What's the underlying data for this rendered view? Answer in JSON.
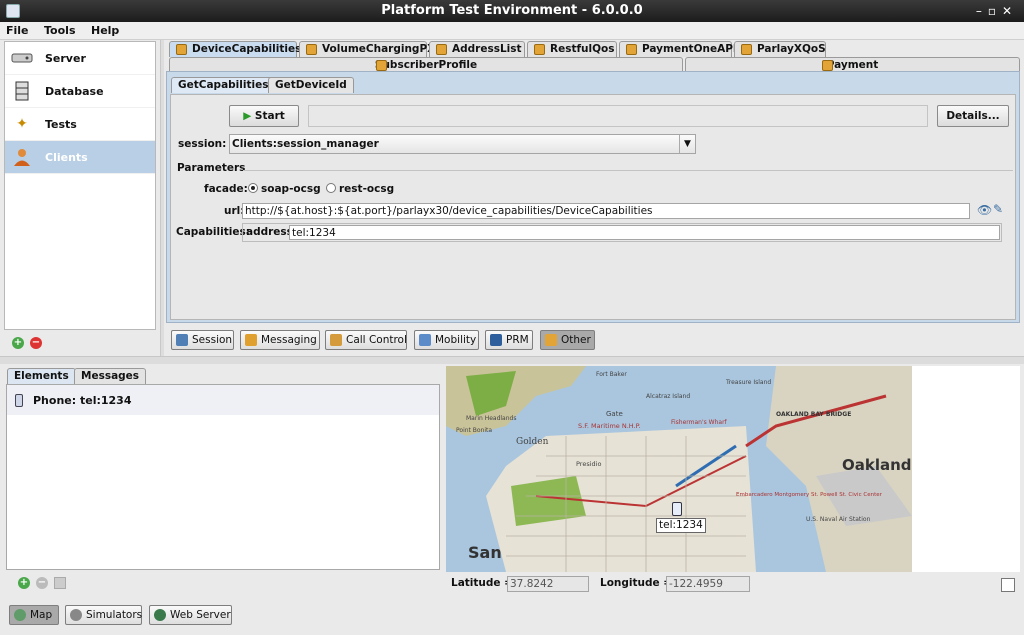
{
  "window": {
    "title": "Platform Test Environment - 6.0.0.0"
  },
  "menu": [
    "File",
    "Tools",
    "Help"
  ],
  "nav": {
    "items": [
      {
        "label": "Server",
        "icon": "server-icon"
      },
      {
        "label": "Database",
        "icon": "database-icon"
      },
      {
        "label": "Tests",
        "icon": "tests-icon"
      },
      {
        "label": "Clients",
        "icon": "clients-icon",
        "selected": true
      }
    ]
  },
  "tabs": {
    "row1": [
      "DeviceCapabilities",
      "VolumeChargingPX",
      "AddressList",
      "RestfulQos",
      "PaymentOneAPI",
      "ParlayXQoS"
    ],
    "row2": [
      "SubscriberProfile",
      "Payment"
    ],
    "active": "DeviceCapabilities"
  },
  "subtabs": [
    "GetCapabilities",
    "GetDeviceId"
  ],
  "form": {
    "start_label": "Start",
    "details_label": "Details...",
    "session_label": "session:",
    "session_value": "Clients:session_manager",
    "parameters_label": "Parameters",
    "facade_label": "facade:",
    "facade_options": [
      "soap-ocsg",
      "rest-ocsg"
    ],
    "facade_selected": "soap-ocsg",
    "url_label": "url:",
    "url_value": "http://${at.host}:${at.port}/parlayx30/device_capabilities/DeviceCapabilities",
    "capabilities_label": "Capabilities:",
    "address_label": "address:",
    "address_value": "tel:1234"
  },
  "bottom_tabs": [
    {
      "label": "Session",
      "icon": "session-icon"
    },
    {
      "label": "Messaging",
      "icon": "messaging-icon"
    },
    {
      "label": "Call Control",
      "icon": "call-control-icon"
    },
    {
      "label": "Mobility",
      "icon": "mobility-icon"
    },
    {
      "label": "PRM",
      "icon": "prm-icon"
    },
    {
      "label": "Other",
      "icon": "other-icon",
      "active": true
    }
  ],
  "lower": {
    "tabs": [
      "Elements",
      "Messages"
    ],
    "element": "Phone: tel:1234"
  },
  "map": {
    "marker_label": "tel:1234",
    "latitude_label": "Latitude =",
    "latitude": "37.8242",
    "longitude_label": "Longitude =",
    "longitude": "-122.4959",
    "labels": [
      "Oakland",
      "San",
      "Golden",
      "Fort Baker",
      "Alcatraz Island",
      "Treasure Island",
      "OAKLAND BAY BRIDGE",
      "S.F. Maritime N.H.P.",
      "Fisherman's Wharf",
      "Gate",
      "Marin Headlands",
      "Point Bonita",
      "Presidio",
      "Embarcadero Montgomery St. Powell St. Civic Center",
      "U.S. Naval Air Station"
    ]
  },
  "footer_tabs": [
    "Map",
    "Simulators",
    "Web Server"
  ]
}
